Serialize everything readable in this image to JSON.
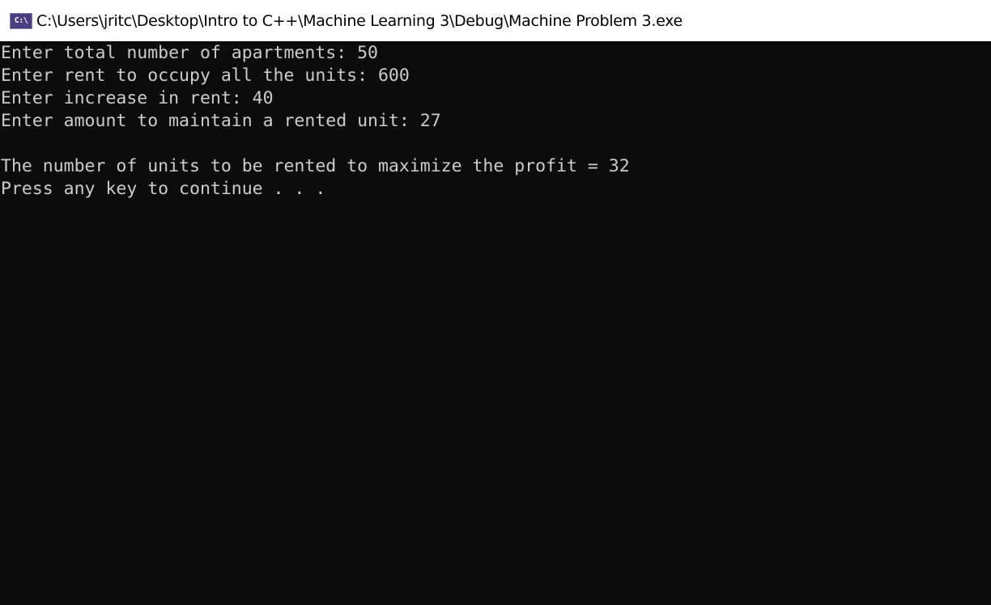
{
  "window": {
    "title": "C:\\Users\\jritc\\Desktop\\Intro to C++\\Machine Learning 3\\Debug\\Machine Problem 3.exe",
    "icon": "console-app-icon",
    "icon_glyph": "C:\\"
  },
  "console": {
    "background": "#0c0c0c",
    "foreground": "#cccccc",
    "lines": [
      "Enter total number of apartments: 50",
      "Enter rent to occupy all the units: 600",
      "Enter increase in rent: 40",
      "Enter amount to maintain a rented unit: 27",
      "",
      "The number of units to be rented to maximize the profit = 32",
      "Press any key to continue . . ."
    ]
  }
}
